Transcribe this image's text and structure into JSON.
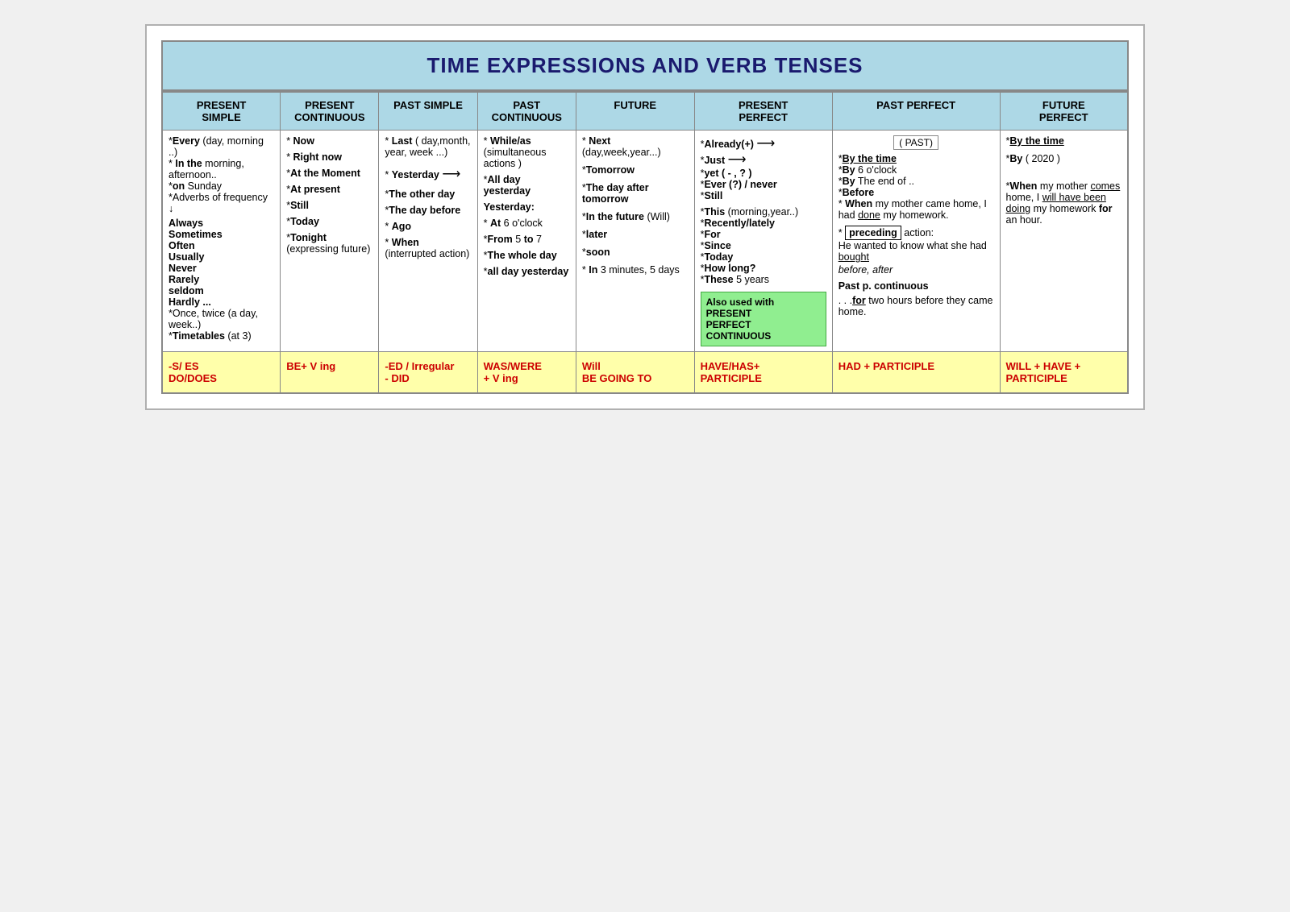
{
  "title": "TIME EXPRESSIONS AND VERB TENSES",
  "columns": [
    {
      "header": "PRESENT\nSIMPLE"
    },
    {
      "header": "PRESENT\nCONTINUOUS"
    },
    {
      "header": "PAST SIMPLE"
    },
    {
      "header": "PAST\nCONTINUOUS"
    },
    {
      "header": "FUTURE"
    },
    {
      "header": "PRESENT\nPERFECT"
    },
    {
      "header": "PAST PERFECT"
    },
    {
      "header": "FUTURE\nPERFECT"
    }
  ],
  "footer": [
    "-S/ ES\nDO/DOES",
    "BE+ V ing",
    "-ED / Irregular\n- DID",
    "WAS/WERE\n+ V ing",
    "Will\nBE GOING TO",
    "HAVE/HAS+\nPARTICIPLE",
    "HAD + PARTICIPLE",
    "WILL + HAVE +\nPARTICIPLE"
  ]
}
